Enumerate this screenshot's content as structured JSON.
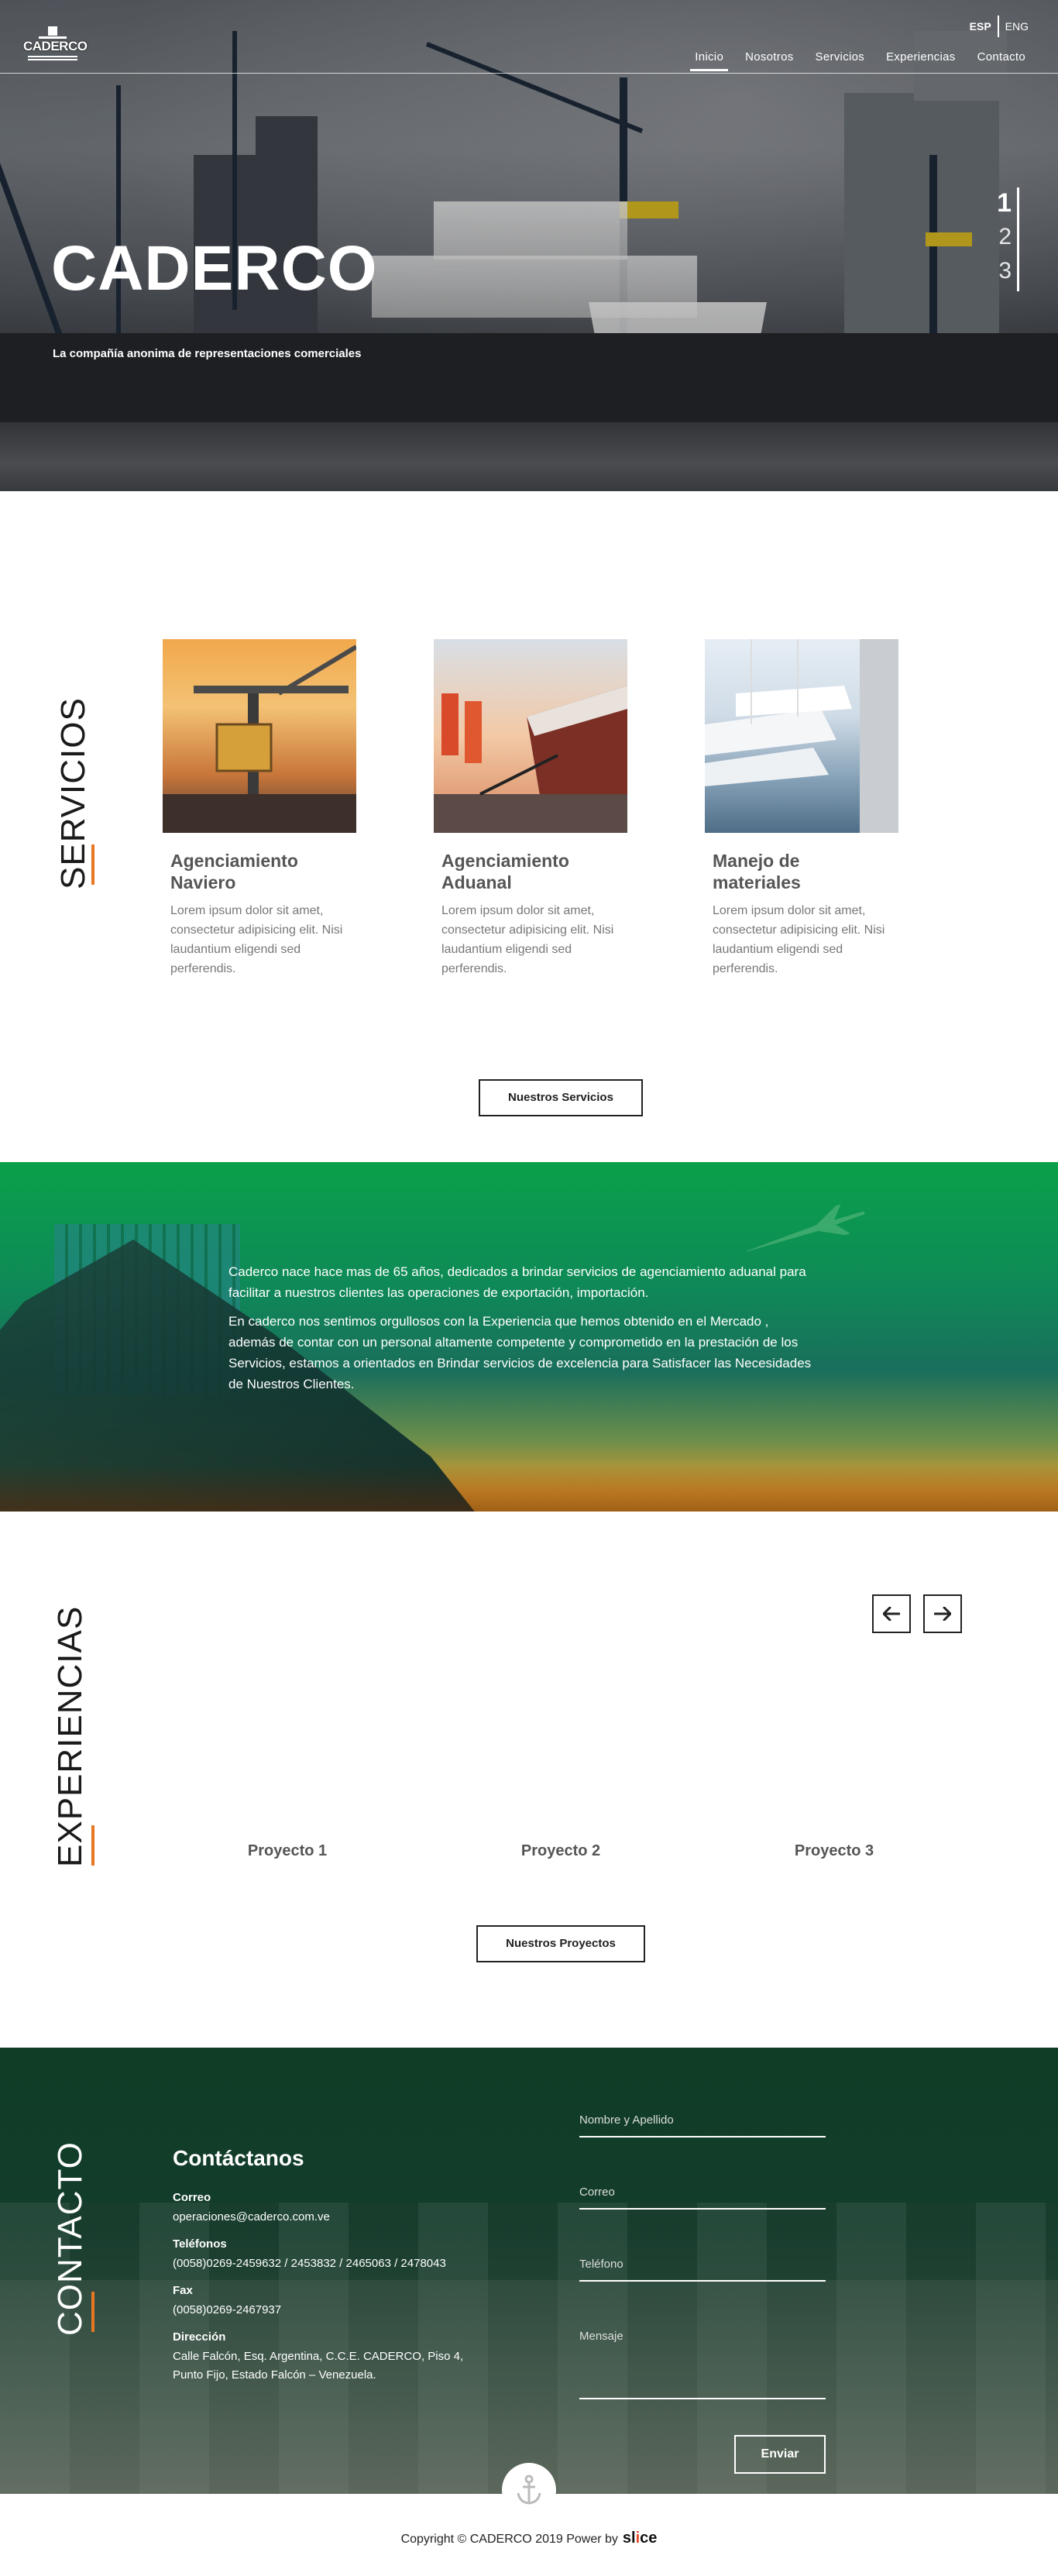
{
  "header": {
    "logo_text": "CADERCO",
    "lang": [
      "ESP",
      "ENG"
    ],
    "nav": [
      "Inicio",
      "Nosotros",
      "Servicios",
      "Experiencias",
      "Contacto"
    ]
  },
  "hero": {
    "title": "CADERCO",
    "subtitle": "La compañía anonima de representaciones comerciales",
    "slides": [
      "1",
      "2",
      "3"
    ]
  },
  "services": {
    "section_title": "SERVICIOS",
    "cards": [
      {
        "title": "Agenciamiento Naviero",
        "text": "Lorem ipsum dolor sit amet, consectetur adipisicing elit. Nisi laudantium eligendi sed perferendis."
      },
      {
        "title": "Agenciamiento Aduanal",
        "text": "Lorem ipsum dolor sit amet, consectetur adipisicing elit. Nisi laudantium eligendi sed perferendis."
      },
      {
        "title": "Manejo de materiales",
        "text": "Lorem ipsum dolor sit amet, consectetur adipisicing elit. Nisi laudantium eligendi sed perferendis."
      }
    ],
    "button": "Nuestros Servicios"
  },
  "about": {
    "p1": "Caderco nace hace mas de 65 años, dedicados a brindar servicios de agenciamiento aduanal para facilitar a nuestros clientes las operaciones de exportación, importación.",
    "p2": "En caderco nos sentimos orgullosos con la Experiencia que hemos obtenido en el Mercado , además de contar con un personal altamente competente y comprometido en la prestación de los Servicios, estamos a orientados en Brindar servicios de excelencia para Satisfacer las Necesidades de Nuestros Clientes."
  },
  "experiences": {
    "section_title": "EXPERIENCIAS",
    "projects": [
      "Proyecto 1",
      "Proyecto 2",
      "Proyecto 3"
    ],
    "button": "Nuestros Proyectos"
  },
  "contact": {
    "section_title": "CONTACTO",
    "title": "Contáctanos",
    "email_label": "Correo",
    "email": "operaciones@caderco.com.ve",
    "phones_label": "Teléfonos",
    "phones": "(0058)0269-2459632 / 2453832 / 2465063 / 2478043",
    "fax_label": "Fax",
    "fax": "(0058)0269-2467937",
    "address_label": "Dirección",
    "address": "Calle Falcón, Esq. Argentina, C.C.E. CADERCO, Piso 4, Punto Fijo, Estado Falcón – Venezuela.",
    "form": {
      "name_placeholder": "Nombre y Apellido",
      "email_placeholder": "Correo",
      "phone_placeholder": "Teléfono",
      "message_placeholder": "Mensaje",
      "submit": "Enviar"
    }
  },
  "footer": {
    "copyright": "Copyright © CADERCO 2019 Power by",
    "brand_s": "sl",
    "brand_c": "i",
    "brand_e": "ce"
  },
  "colors": {
    "accent": "#e87722",
    "green": "#0aa04a",
    "dark_green": "#0f3d25"
  }
}
